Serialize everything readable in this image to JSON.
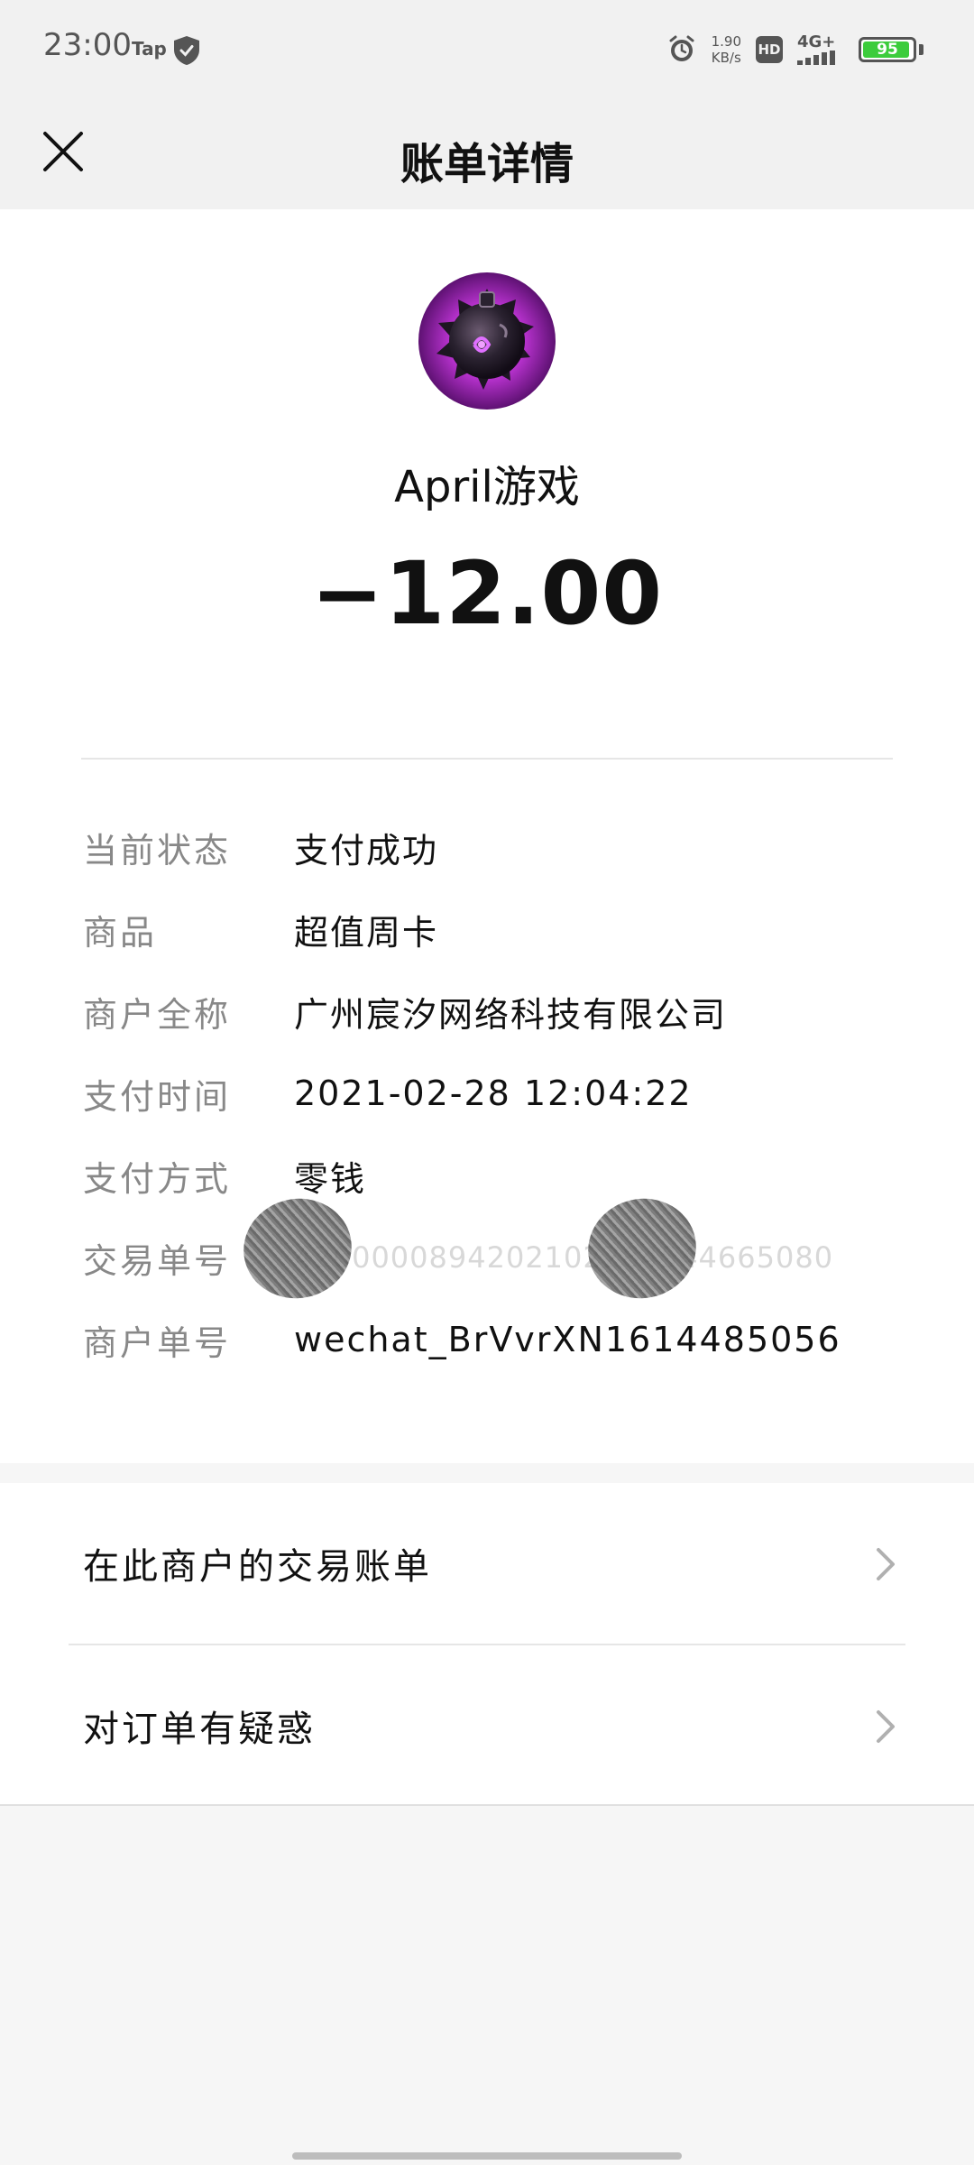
{
  "status_bar": {
    "time": "23:00",
    "tap_label": "Tap",
    "speed_value": "1.90",
    "speed_unit": "KB/s",
    "hd_label": "HD",
    "network_label": "4G+",
    "battery_level": "95",
    "icons": [
      "shield-icon",
      "alarm-icon",
      "signal-icon",
      "battery-icon"
    ]
  },
  "header": {
    "title": "账单详情",
    "close_icon": "close-icon"
  },
  "transaction": {
    "merchant_name": "April游戏",
    "amount": "−12.00"
  },
  "details": [
    {
      "label": "当前状态",
      "value": "支付成功"
    },
    {
      "label": "商品",
      "value": "超值周卡"
    },
    {
      "label": "商户全称",
      "value": "广州宸汐网络科技有限公司"
    },
    {
      "label": "支付时间",
      "value": "2021-02-28 12:04:22"
    },
    {
      "label": "支付方式",
      "value": "零钱"
    },
    {
      "label": "交易单号",
      "value": "4200000894202102284544665080"
    },
    {
      "label": "商户单号",
      "value": "wechat_BrVvrXN1614485056"
    }
  ],
  "menu": [
    {
      "label": "在此商户的交易账单",
      "icon": "chevron-right-icon"
    },
    {
      "label": "对订单有疑惑",
      "icon": "chevron-right-icon"
    }
  ],
  "colors": {
    "battery_fill": "#3ccc3c",
    "header_bg": "#f1f1f1",
    "card_bg": "#ffffff",
    "label_text": "#888888"
  }
}
